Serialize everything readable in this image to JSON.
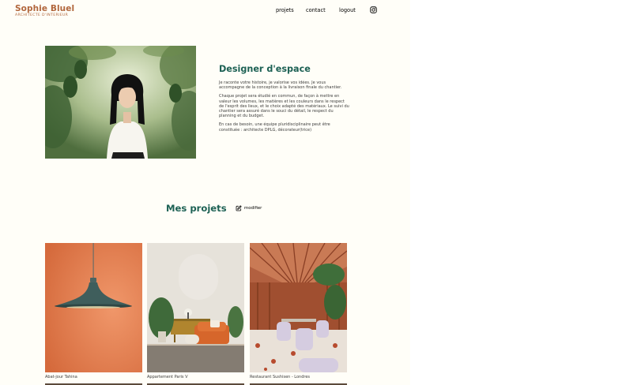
{
  "header": {
    "brand_name": "Sophie Bluel",
    "brand_subtitle": "ARCHITECTE D'INTERIEUR",
    "nav": [
      {
        "label": "projets"
      },
      {
        "label": "contact"
      },
      {
        "label": "logout"
      }
    ],
    "instagram_icon": "instagram-icon"
  },
  "intro": {
    "title": "Designer d'espace",
    "paragraphs": [
      "Je raconte votre histoire, je valorise vos idées. Je vous accompagne de la conception à la livraison finale du chantier.",
      "Chaque projet sera étudié en commun, de façon à mettre en valeur les volumes, les matières et les couleurs dans le respect de l'esprit des lieux, et le choix adapté des matériaux. Le suivi du chantier sera assuré dans le souci du détail, le respect du planning et du budget.",
      "En cas de besoin, une équipe pluridisciplinaire peut être constituée : architecte DPLG, décorateur(trice)"
    ]
  },
  "projects": {
    "title": "Mes projets",
    "edit_label": "modifier",
    "edit_icon": "pen-square-icon",
    "items": [
      {
        "caption": "Abat-jour Tahina"
      },
      {
        "caption": "Appartement Paris V"
      },
      {
        "caption": "Restaurant Sushisen - Londres"
      }
    ]
  },
  "colors": {
    "brand": "#b1663c",
    "accent": "#1d6154",
    "background": "#fffef8"
  }
}
